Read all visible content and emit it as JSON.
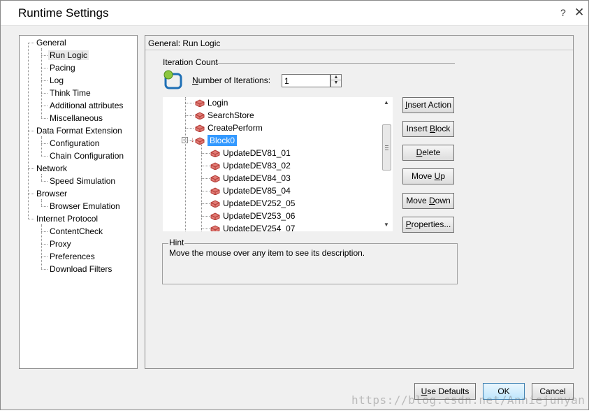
{
  "window": {
    "title": "Runtime Settings",
    "help_glyph": "?",
    "close_glyph": "✕"
  },
  "nav": {
    "items": [
      {
        "label": "General",
        "level": 0
      },
      {
        "label": "Run Logic",
        "level": 1,
        "selected": true
      },
      {
        "label": "Pacing",
        "level": 1
      },
      {
        "label": "Log",
        "level": 1
      },
      {
        "label": "Think Time",
        "level": 1
      },
      {
        "label": "Additional attributes",
        "level": 1
      },
      {
        "label": "Miscellaneous",
        "level": 1
      },
      {
        "label": "Data Format Extension",
        "level": 0
      },
      {
        "label": "Configuration",
        "level": 1
      },
      {
        "label": "Chain Configuration",
        "level": 1
      },
      {
        "label": "Network",
        "level": 0
      },
      {
        "label": "Speed Simulation",
        "level": 1
      },
      {
        "label": "Browser",
        "level": 0
      },
      {
        "label": "Browser Emulation",
        "level": 1
      },
      {
        "label": "Internet Protocol",
        "level": 0
      },
      {
        "label": "ContentCheck",
        "level": 1
      },
      {
        "label": "Proxy",
        "level": 1
      },
      {
        "label": "Preferences",
        "level": 1
      },
      {
        "label": "Download Filters",
        "level": 1
      }
    ]
  },
  "panel": {
    "header": "General: Run Logic",
    "iteration_group": "Iteration Count",
    "iterations_label": "Number of Iterations:",
    "iterations_value": "1"
  },
  "action_tree": {
    "items": [
      {
        "label": "Login",
        "level": 0
      },
      {
        "label": "SearchStore",
        "level": 0
      },
      {
        "label": "CreatePerform",
        "level": 0
      },
      {
        "label": "Block0",
        "level": 0,
        "selected": true,
        "expanded": true
      },
      {
        "label": "UpdateDEV81_01",
        "level": 1
      },
      {
        "label": "UpdateDEV83_02",
        "level": 1
      },
      {
        "label": "UpdateDEV84_03",
        "level": 1
      },
      {
        "label": "UpdateDEV85_04",
        "level": 1
      },
      {
        "label": "UpdateDEV252_05",
        "level": 1
      },
      {
        "label": "UpdateDEV253_06",
        "level": 1
      },
      {
        "label": "UpdateDEV254_07",
        "level": 1
      }
    ]
  },
  "actions": {
    "insert_action": {
      "pre": "",
      "key": "I",
      "post": "nsert Action"
    },
    "insert_block": {
      "pre": "Insert ",
      "key": "B",
      "post": "lock"
    },
    "delete": {
      "pre": "",
      "key": "D",
      "post": "elete"
    },
    "move_up": {
      "pre": "Move ",
      "key": "U",
      "post": "p"
    },
    "move_down": {
      "pre": "Move ",
      "key": "D",
      "post": "own"
    },
    "properties": {
      "pre": "",
      "key": "P",
      "post": "roperties..."
    }
  },
  "hint": {
    "title": "Hint",
    "text": "Move the mouse over any item to see its description."
  },
  "footer": {
    "use_defaults": {
      "pre": "",
      "key": "U",
      "post": "se Defaults"
    },
    "ok": "OK",
    "cancel": "Cancel"
  },
  "watermark": "https://blog.csdn.net/Anniejunyan",
  "colors": {
    "selection": "#3399ff",
    "action_icon": "#d9534f",
    "iteration_icon": "#1e6fb5"
  }
}
